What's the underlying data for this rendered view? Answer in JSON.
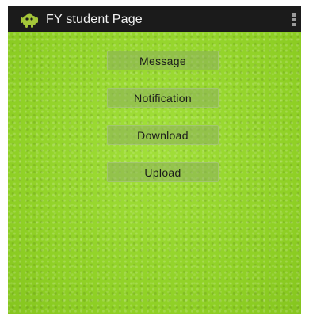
{
  "app": {
    "title": "FY student Page",
    "icon": "android-icon"
  },
  "action_bar": {
    "overflow_icon": "overflow-menu-icon",
    "background_color": "#1b1b1b"
  },
  "content": {
    "background_color": "#97d82e",
    "buttons": [
      {
        "label": "Message"
      },
      {
        "label": "Notification"
      },
      {
        "label": "Download"
      },
      {
        "label": "Upload"
      }
    ]
  }
}
